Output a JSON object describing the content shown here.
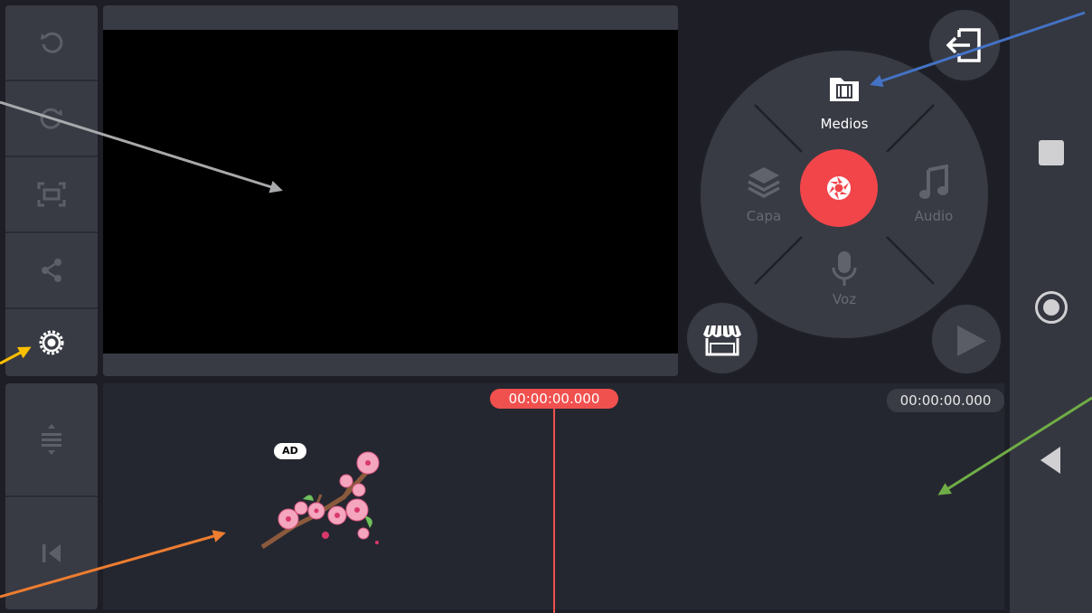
{
  "menu": {
    "media_label": "Medios",
    "layer_label": "Capa",
    "audio_label": "Audio",
    "voice_label": "Voz"
  },
  "timeline": {
    "playhead_time": "00:00:00.000",
    "total_time": "00:00:00.000",
    "ad_badge": "AD"
  },
  "colors": {
    "accent_red": "#f2454a",
    "annotation_gray": "#a7a9ab",
    "annotation_blue": "#4472c4",
    "annotation_yellow": "#ffc000",
    "annotation_orange": "#ed7d31",
    "annotation_green": "#70ad47"
  },
  "icons": {
    "left_toolbar": [
      "undo-icon",
      "redo-icon",
      "fit-screen-icon",
      "share-icon",
      "settings-icon"
    ],
    "left_toolbar_bottom": [
      "track-spacing-icon",
      "skip-to-start-icon"
    ],
    "menu": [
      "media-folder-icon",
      "layers-icon",
      "music-note-icon",
      "microphone-icon",
      "camera-shutter-icon"
    ],
    "nav": [
      "square-icon",
      "circle-icon",
      "back-triangle-icon"
    ]
  }
}
